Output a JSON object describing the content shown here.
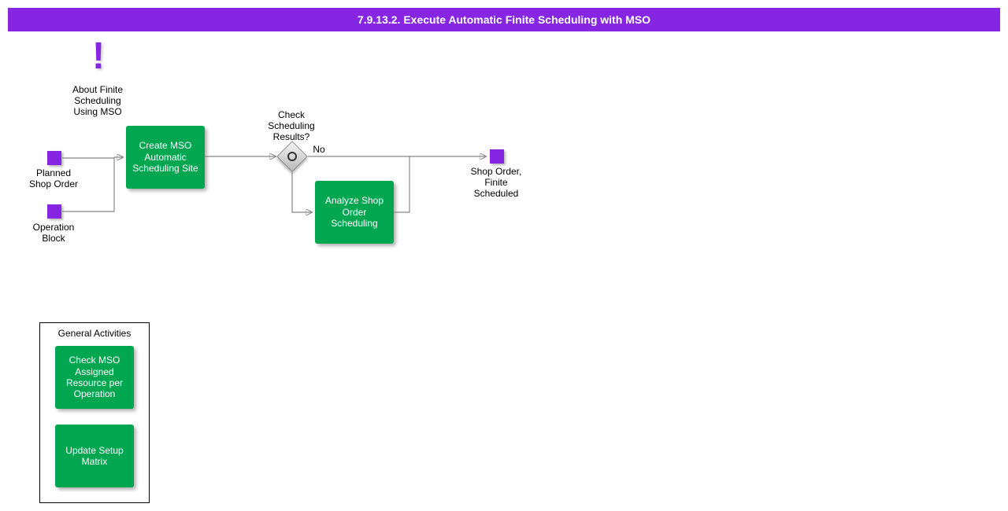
{
  "title": "7.9.13.2. Execute Automatic Finite Scheduling with MSO",
  "info": {
    "label": "About Finite\nScheduling\nUsing MSO"
  },
  "inputs": {
    "planned_shop_order": "Planned\nShop Order",
    "operation_block": "Operation\nBlock"
  },
  "activities": {
    "create_mso": "Create MSO\nAutomatic\nScheduling Site",
    "analyze": "Analyze Shop\nOrder\nScheduling"
  },
  "gateway": {
    "label": "Check\nScheduling\nResults?",
    "no": "No"
  },
  "output": {
    "label": "Shop Order,\nFinite\nScheduled"
  },
  "general_activities": {
    "title": "General Activities",
    "check_mso": "Check MSO\nAssigned\nResource per\nOperation",
    "update_matrix": "Update Setup\nMatrix"
  }
}
